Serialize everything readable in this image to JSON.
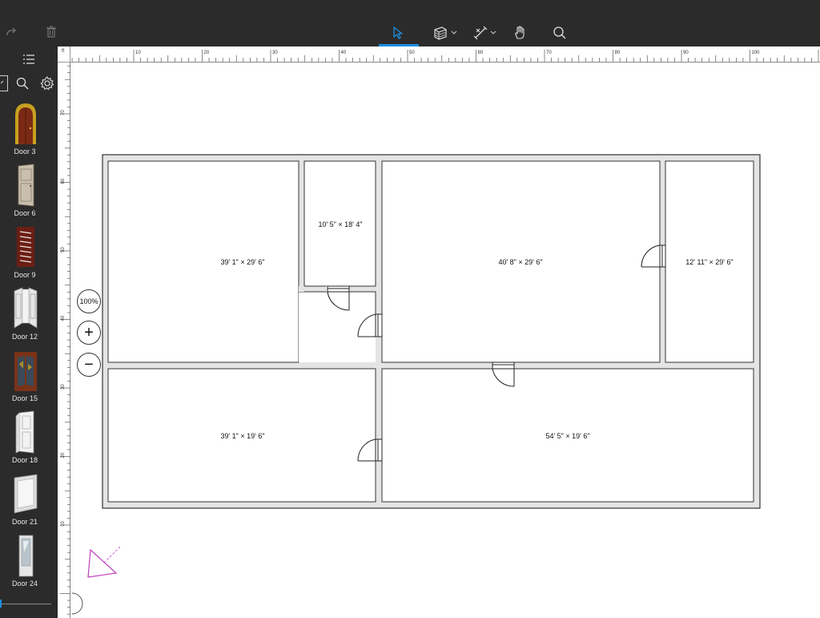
{
  "toolbar": {
    "tools": [
      {
        "name": "select-tool",
        "icon": "cursor-arrow-icon",
        "active": true
      },
      {
        "name": "wall-tool",
        "icon": "wall-icon",
        "has_menu": true
      },
      {
        "name": "dimension-tool",
        "icon": "dimension-icon",
        "has_menu": true
      },
      {
        "name": "pan-tool",
        "icon": "hand-icon"
      },
      {
        "name": "zoom-tool",
        "icon": "magnifier-icon"
      }
    ],
    "accent_color": "#1a8fe0"
  },
  "sidebar": {
    "items": [
      {
        "label": "Door 3",
        "icon": "arched-door-icon",
        "color": "#7a2a14"
      },
      {
        "label": "Door 6",
        "icon": "panel-door-icon",
        "color": "#c8bfae"
      },
      {
        "label": "Door 9",
        "icon": "louvered-door-icon",
        "color": "#6b1f14"
      },
      {
        "label": "Door 12",
        "icon": "double-door-icon",
        "color": "#e6e6e6"
      },
      {
        "label": "Door 15",
        "icon": "glass-double-door-icon",
        "color": "#7a3218"
      },
      {
        "label": "Door 18",
        "icon": "white-door-icon",
        "color": "#f2f2f2"
      },
      {
        "label": "Door 21",
        "icon": "glass-door-icon",
        "color": "#dcdcdc"
      },
      {
        "label": "Door 24",
        "icon": "glazed-door-icon",
        "color": "#e6e6e6"
      }
    ]
  },
  "ruler": {
    "unit": "ft",
    "h_labels": [
      "10",
      "20",
      "30",
      "40",
      "50",
      "60",
      "70",
      "80",
      "90",
      "100"
    ],
    "v_labels": [
      "70",
      "60",
      "50",
      "40",
      "30",
      "20",
      "10"
    ]
  },
  "zoom": {
    "level": "100%",
    "in_symbol": "+",
    "out_symbol": "−"
  },
  "rooms": [
    {
      "label": "39' 1\" × 29' 6\""
    },
    {
      "label": "10' 5\" × 18' 4\""
    },
    {
      "label": "40' 8\" × 29' 6\""
    },
    {
      "label": "12' 11\" × 29' 6\""
    },
    {
      "label": "39' 1\" × 19' 6\""
    },
    {
      "label": "54' 5\" × 19' 6\""
    }
  ]
}
